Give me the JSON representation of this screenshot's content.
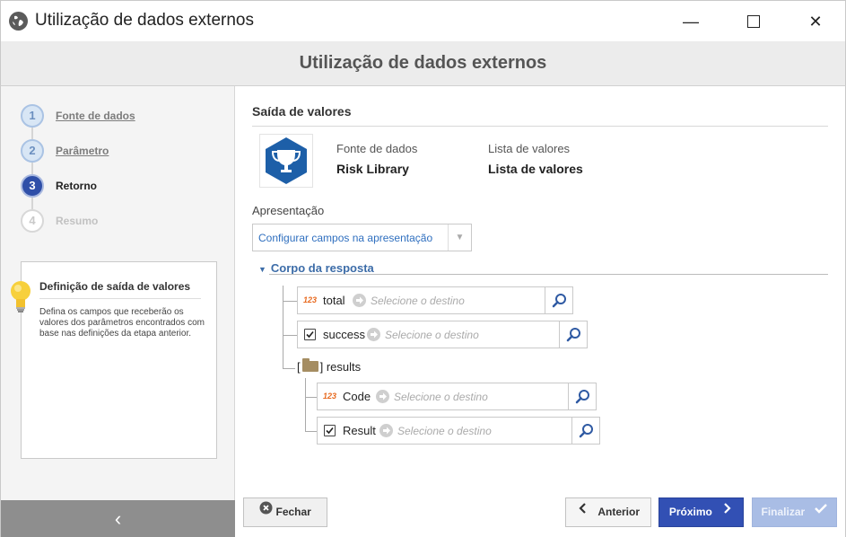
{
  "window": {
    "title": "Utilização de dados externos",
    "app_icon": "globe-icon",
    "minimize_glyph": "—",
    "close_glyph": "✕"
  },
  "header": {
    "title": "Utilização de dados externos"
  },
  "steps": [
    {
      "number": "1",
      "label": "Fonte de dados",
      "state": "done"
    },
    {
      "number": "2",
      "label": "Parâmetro",
      "state": "done"
    },
    {
      "number": "3",
      "label": "Retorno",
      "state": "active"
    },
    {
      "number": "4",
      "label": "Resumo",
      "state": "todo"
    }
  ],
  "help": {
    "title": "Definição de saída de valores",
    "text": "Defina os campos que receberão os valores dos parâmetros encontrados com base nas definições da etapa anterior."
  },
  "sidebar": {
    "collapse_glyph": "‹"
  },
  "main": {
    "section_title": "Saída de valores",
    "source_label": "Fonte de dados",
    "source_value": "Risk Library",
    "list_label": "Lista de valores",
    "list_value": "Lista de valores",
    "presentation_label": "Apresentação",
    "presentation_value": "Configurar campos na apresentação",
    "tree_title": "Corpo da resposta",
    "folder_open": "[",
    "folder_close": "] results"
  },
  "fields": [
    {
      "type": "number",
      "type_label": "123",
      "name": "total",
      "placeholder": "Selecione o destino"
    },
    {
      "type": "boolean",
      "name": "success",
      "placeholder": "Selecione o destino"
    },
    {
      "type": "number",
      "type_label": "123",
      "name": "Code",
      "placeholder": "Selecione o destino"
    },
    {
      "type": "boolean",
      "name": "Result",
      "placeholder": "Selecione o destino"
    }
  ],
  "buttons": {
    "close": "Fechar",
    "previous": "Anterior",
    "next": "Próximo",
    "finish": "Finalizar"
  },
  "colors": {
    "accent": "#3250b4",
    "link": "#3c6ca8",
    "number_type": "#e86a1f",
    "trophy": "#1d5fa8"
  }
}
